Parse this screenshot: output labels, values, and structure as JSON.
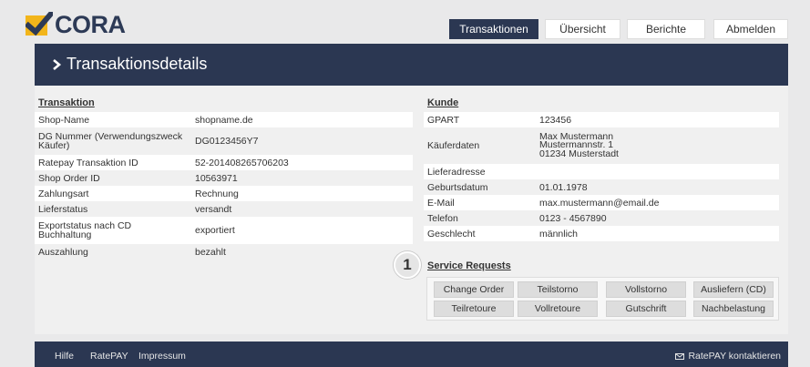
{
  "logo": {
    "text": "CORA"
  },
  "nav": [
    {
      "label": "Transaktionen",
      "active": true
    },
    {
      "label": "Übersicht",
      "active": false
    },
    {
      "label": "Berichte",
      "active": false
    },
    {
      "label": "Abmelden",
      "active": false
    }
  ],
  "header": {
    "title": "Transaktionsdetails"
  },
  "transaktion": {
    "title": "Transaktion",
    "rows": [
      {
        "key": "Shop-Name",
        "value": "shopname.de"
      },
      {
        "key": "DG Nummer (Verwendungszweck Käufer)",
        "value": "DG0123456Y7"
      },
      {
        "key": "Ratepay Transaktion ID",
        "value": "52-201408265706203"
      },
      {
        "key": "Shop Order ID",
        "value": "10563971"
      },
      {
        "key": "Zahlungsart",
        "value": "Rechnung"
      },
      {
        "key": "Lieferstatus",
        "value": "versandt"
      },
      {
        "key": "Exportstatus nach CD Buchhaltung",
        "value": "exportiert"
      },
      {
        "key": "Auszahlung",
        "value": "bezahlt"
      }
    ]
  },
  "kunde": {
    "title": "Kunde",
    "rows": [
      {
        "key": "GPART",
        "value": "123456"
      },
      {
        "key": "Käuferdaten",
        "value": "Max Mustermann\nMustermannstr. 1\n01234 Musterstadt"
      },
      {
        "key": "Lieferadresse",
        "value": ""
      },
      {
        "key": "Geburtsdatum",
        "value": "01.01.1978"
      },
      {
        "key": "E-Mail",
        "value": "max.mustermann@email.de"
      },
      {
        "key": "Telefon",
        "value": "0123 - 4567890"
      },
      {
        "key": "Geschlecht",
        "value": "männlich"
      }
    ]
  },
  "badge": {
    "number": "1"
  },
  "service": {
    "title": "Service Requests",
    "buttons": [
      "Change Order",
      "Teilstorno",
      "Vollstorno",
      "Ausliefern (CD)",
      "Teilretoure",
      "Vollretoure",
      "Gutschrift",
      "Nachbelastung"
    ]
  },
  "footer": {
    "links": [
      "Hilfe",
      "RatePAY",
      "Impressum"
    ],
    "contact": "RatePAY kontaktieren"
  },
  "colors": {
    "navy": "#2b3752",
    "logo_yellow": "#f2b51b",
    "background": "#e9e9ea"
  }
}
